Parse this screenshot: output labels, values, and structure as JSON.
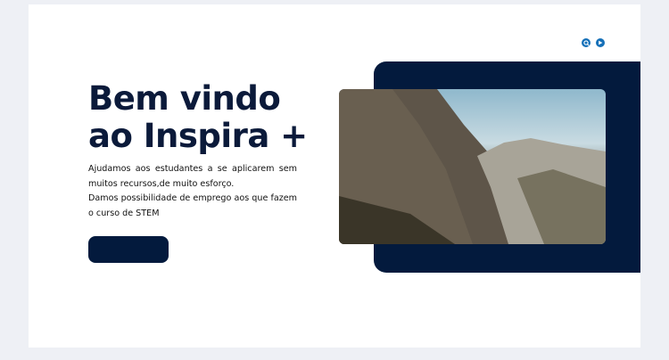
{
  "hero": {
    "title_line1": "Bem vindo",
    "title_line2": "ao Inspira +",
    "desc1": "Ajudamos aos estudantes a se aplicarem sem muitos recursos,de muito esforço.",
    "desc2": "Damos possibilidade de emprego aos que fazem o curso de STEM"
  },
  "icons": [
    "search-icon",
    "play-icon"
  ],
  "colors": {
    "navy": "#031a3d",
    "accent": "#1570b8"
  }
}
